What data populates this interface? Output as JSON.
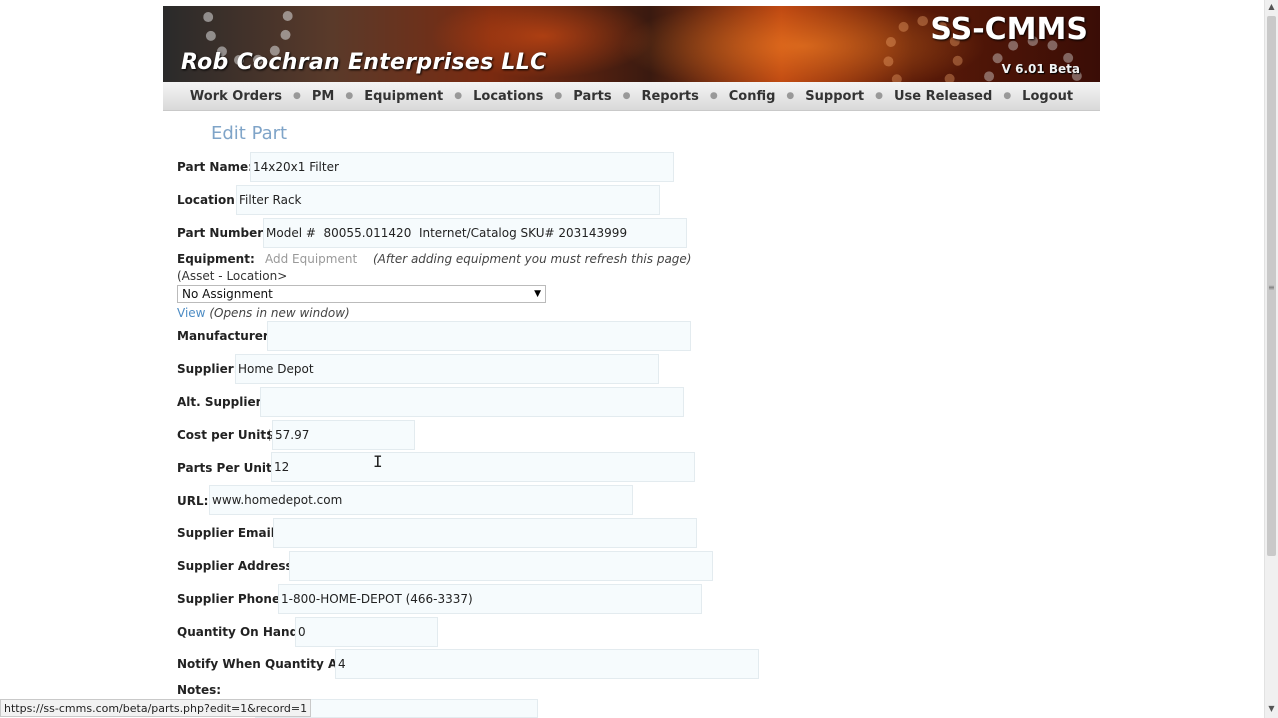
{
  "header": {
    "company": "Rob Cochran Enterprises LLC",
    "app_name": "SS-CMMS",
    "version": "V 6.01 Beta"
  },
  "nav": {
    "items": [
      "Work Orders",
      "PM",
      "Equipment",
      "Locations",
      "Parts",
      "Reports",
      "Config",
      "Support",
      "Use Released",
      "Logout"
    ]
  },
  "page": {
    "title": "Edit Part"
  },
  "form": {
    "part_name": {
      "label": "Part Name:",
      "value": "14x20x1 Filter"
    },
    "location": {
      "label": "Location:",
      "value": "Filter Rack"
    },
    "part_number": {
      "label": "Part Number:",
      "value": "Model #  80055.011420  Internet/Catalog SKU# 203143999"
    },
    "equipment": {
      "label": "Equipment:",
      "sublabel": "(Asset - Location>",
      "add_link": "Add Equipment",
      "hint": "(After adding equipment you must refresh this page)",
      "select_value": "No Assignment",
      "view_link": "View",
      "view_hint": "(Opens in new window)"
    },
    "manufacturer": {
      "label": "Manufacturer:",
      "value": ""
    },
    "supplier": {
      "label": "Supplier:",
      "value": "Home Depot"
    },
    "alt_supplier": {
      "label": "Alt. Supplier:",
      "value": ""
    },
    "cost_per_unit": {
      "label": "Cost per Unit:",
      "currency": "$",
      "value": "57.97"
    },
    "parts_per_unit": {
      "label": "Parts Per Unit:",
      "value": "12"
    },
    "url": {
      "label": "URL:",
      "value": "www.homedepot.com"
    },
    "supplier_email": {
      "label": "Supplier Email:",
      "value": ""
    },
    "supplier_address": {
      "label": "Supplier Address:",
      "value": ""
    },
    "supplier_phone": {
      "label": "Supplier Phone:",
      "value": "1-800-HOME-DEPOT (466-3337)"
    },
    "quantity_on_hand": {
      "label": "Quantity On Hand:",
      "value": "0"
    },
    "notify_quantity": {
      "label": "Notify When Quantity At:",
      "value": "4"
    },
    "notes": {
      "label": "Notes:",
      "value": ""
    }
  },
  "statusbar": {
    "url": "https://ss-cmms.com/beta/parts.php?edit=1&record=1"
  }
}
